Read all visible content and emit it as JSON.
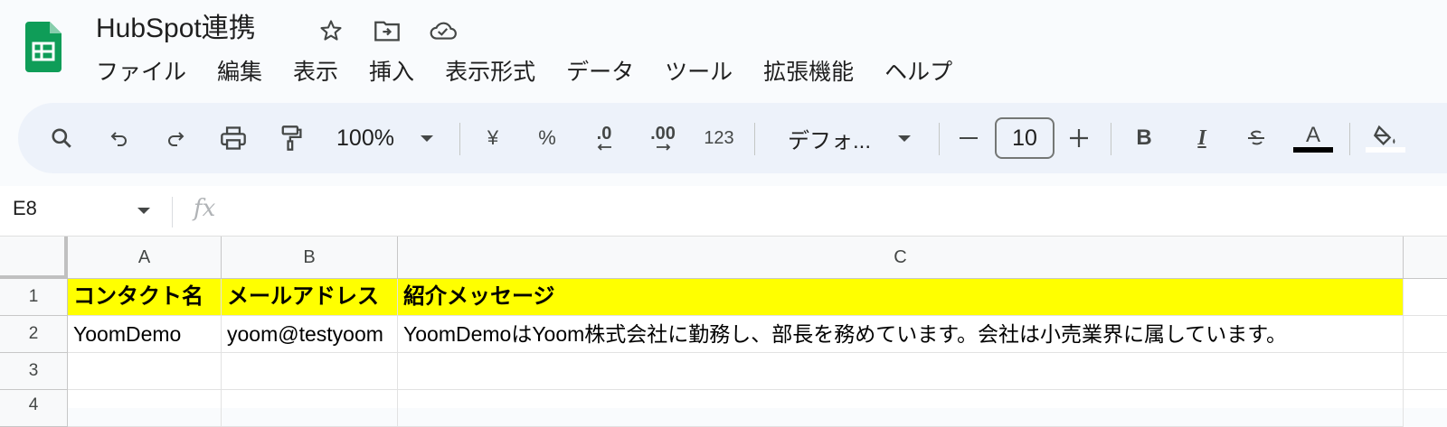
{
  "document": {
    "title": "HubSpot連携"
  },
  "menu": [
    "ファイル",
    "編集",
    "表示",
    "挿入",
    "表示形式",
    "データ",
    "ツール",
    "拡張機能",
    "ヘルプ"
  ],
  "toolbar": {
    "zoom": "100%",
    "currency": "¥",
    "percent": "%",
    "decrease_decimal": ".0",
    "increase_decimal": ".00",
    "number_format": "123",
    "font": "デフォ...",
    "font_size": "10",
    "bold": "B",
    "italic": "I",
    "text_color_label": "A",
    "text_color": "#000000"
  },
  "formula_bar": {
    "name_box": "E8",
    "fx": "fx",
    "value": ""
  },
  "sheet": {
    "columns": [
      "A",
      "B",
      "C"
    ],
    "rows": [
      "1",
      "2",
      "3",
      "4"
    ],
    "cells": [
      [
        "コンタクト名",
        "メールアドレス",
        "紹介メッセージ"
      ],
      [
        "YoomDemo",
        "yoom@testyoom",
        "YoomDemoはYoom株式会社に勤務し、部長を務めています。会社は小売業界に属しています。"
      ],
      [
        "",
        "",
        ""
      ]
    ],
    "header_fill": "#ffff00"
  }
}
